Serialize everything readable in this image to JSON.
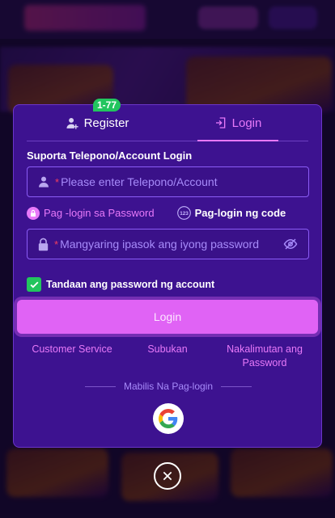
{
  "modal": {
    "tabs": [
      {
        "label": "Register",
        "badge": "1-77",
        "icon": "user-add-icon"
      },
      {
        "label": "Login",
        "icon": "login-door-icon",
        "active": true
      }
    ],
    "section_title": "Suporta Telepono/Account Login",
    "account_input": {
      "required_mark": "*",
      "placeholder": "Please enter Telepono/Account",
      "icon": "user-icon"
    },
    "login_modes": [
      {
        "label": "Pag -login sa Password",
        "icon": "lock-icon"
      },
      {
        "label": "Pag-login ng code",
        "icon": "code-123-icon"
      }
    ],
    "password_input": {
      "required_mark": "*",
      "placeholder": "Mangyaring ipasok ang iyong password",
      "icon": "lock-icon",
      "toggle_icon": "eye-off-icon"
    },
    "remember": {
      "label": "Tandaan ang password ng account",
      "checked": true
    },
    "login_button": "Login",
    "links": {
      "customer_service": "Customer Service",
      "try": "Subukan",
      "forgot_line1": "Nakalimutan ang",
      "forgot_line2": "Password"
    },
    "quick_login": "Mabilis Na Pag-login"
  },
  "colors": {
    "accent": "#e879f9",
    "panel": "#3d1290",
    "badge": "#22c55e",
    "button": "#e063f5"
  }
}
